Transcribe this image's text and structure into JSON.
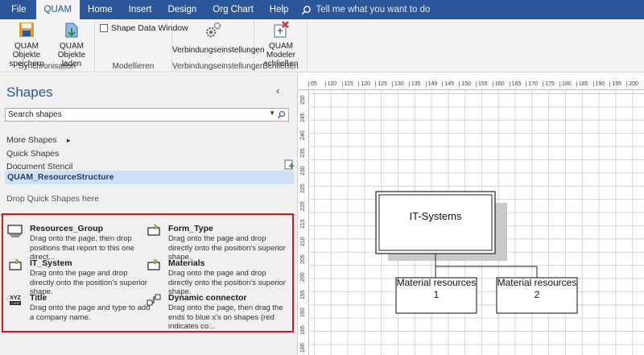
{
  "tabs": [
    "File",
    "QUAM",
    "Home",
    "Insert",
    "Design",
    "Org Chart",
    "Help"
  ],
  "tell_me": "Tell me what you want to do",
  "ribbon": {
    "synchronisation": {
      "save_line1": "QUAM Objekte",
      "save_line2": "speichern",
      "load_line1": "QUAM",
      "load_line2": "Objekte laden",
      "label": "Synchronisation"
    },
    "modellieren": {
      "shape_data_window": "Shape Data Window",
      "label": "Modellieren"
    },
    "verbindung": {
      "button": "Verbindungseinstellungen",
      "label": "Verbindungseinstellungen"
    },
    "schliessen": {
      "line1": "QUAM Modeler",
      "line2": "schließen",
      "label": "Schließen"
    }
  },
  "shapes_panel": {
    "title": "Shapes",
    "search_placeholder": "Search shapes",
    "more_shapes": "More Shapes",
    "quick_shapes": "Quick Shapes",
    "document_stencil": "Document Stencil",
    "active_stencil": "QUAM_ResourceStructure",
    "drop_hint": "Drop Quick Shapes here",
    "shapes": [
      {
        "name": "Resources_Group",
        "desc": "Drag onto the page, then drop positions that report to this one direct..."
      },
      {
        "name": "Form_Type",
        "desc": "Drag onto the page and drop directly onto the position's superior shape."
      },
      {
        "name": "IT_System",
        "desc": "Drag onto the page and drop directly onto the position's superior shape."
      },
      {
        "name": "Materials",
        "desc": "Drag onto the page and drop directly onto the position's superior shape."
      },
      {
        "name": "Title",
        "desc": "Drag onto the page and type to add a company name."
      },
      {
        "name": "Dynamic connector",
        "desc": "Drag onto the page, then drag the ends to blue x's on shapes (red indicates co..."
      }
    ],
    "title_icon_text": "XYZ CORP"
  },
  "ruler": {
    "h": [
      "05",
      "110",
      "115",
      "120",
      "125",
      "130",
      "135",
      "140",
      "145",
      "150",
      "155",
      "160",
      "165",
      "170",
      "175",
      "180",
      "185",
      "190",
      "195",
      "200"
    ],
    "v": [
      "250",
      "245",
      "240",
      "235",
      "230",
      "225",
      "220",
      "215",
      "210",
      "205",
      "200",
      "195",
      "190",
      "185",
      "180"
    ]
  },
  "diagram": {
    "root": "IT-Systems",
    "child1_line1": "Material resources",
    "child1_line2": "1",
    "child2_line1": "Material resources",
    "child2_line2": "2"
  }
}
